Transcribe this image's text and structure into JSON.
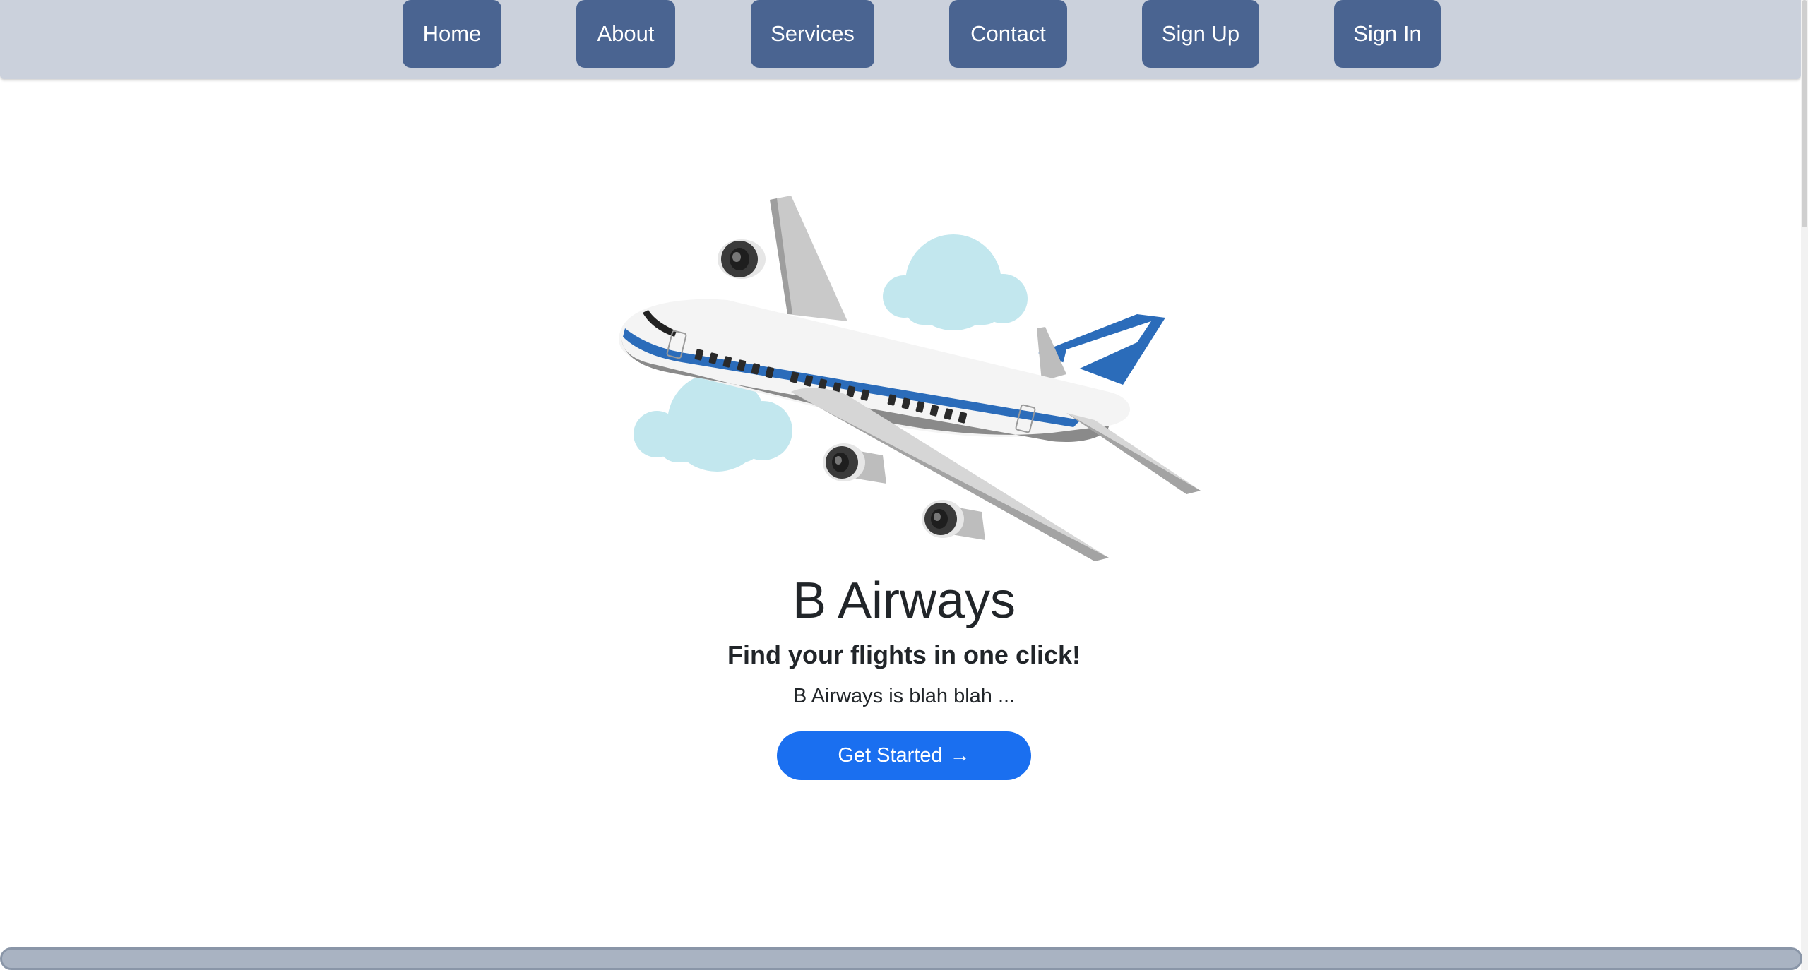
{
  "nav": {
    "items": [
      {
        "id": "home",
        "label": "Home"
      },
      {
        "id": "about",
        "label": "About"
      },
      {
        "id": "services",
        "label": "Services"
      },
      {
        "id": "contact",
        "label": "Contact"
      },
      {
        "id": "signup",
        "label": "Sign Up"
      },
      {
        "id": "signin",
        "label": "Sign In"
      }
    ],
    "background": "#cbd1dc",
    "button_color": "#4a6491"
  },
  "hero": {
    "image_icon": "airplane-illustration",
    "title": "B Airways",
    "subtitle": "Find your flights in one click!",
    "text": "B Airways is blah blah ...",
    "cta_label": "Get Started",
    "cta_arrow": "→",
    "cta_color": "#1a6ff0"
  }
}
